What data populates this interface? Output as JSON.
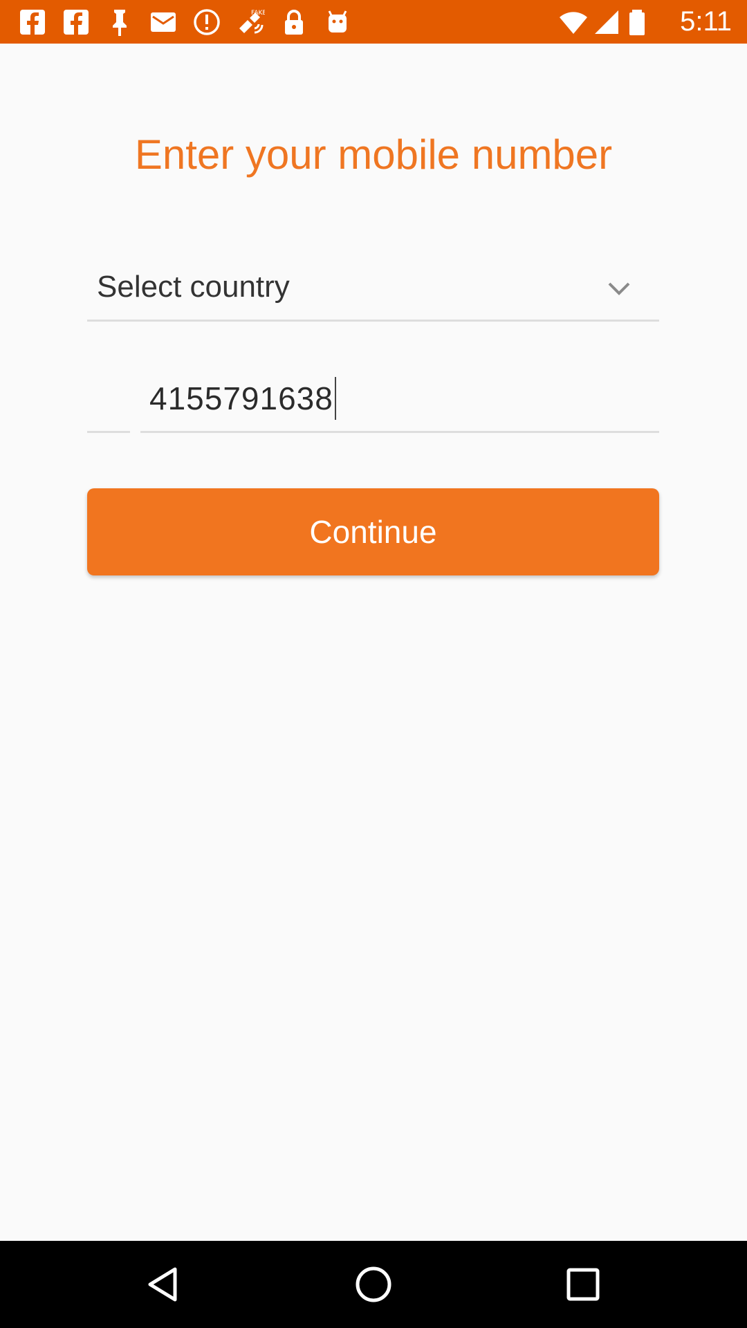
{
  "status_bar": {
    "time": "5:11",
    "background": "#e35b00",
    "left_icons": [
      "facebook-icon",
      "facebook-icon",
      "pin-icon",
      "mail-icon",
      "alert-icon",
      "fake-gps-icon",
      "lock-icon",
      "android-icon"
    ],
    "right_icons": [
      "wifi-icon",
      "signal-icon",
      "battery-icon"
    ]
  },
  "main": {
    "title": "Enter your mobile number",
    "title_color": "#ef7622",
    "country_select": {
      "value": "Select country",
      "icon": "chevron-down-icon"
    },
    "country_code": {
      "value": ""
    },
    "phone_number": {
      "value": "4155791638"
    },
    "continue_button": {
      "label": "Continue",
      "color": "#f1751f"
    }
  },
  "nav_bar": {
    "buttons": [
      "back-icon",
      "home-icon",
      "recents-icon"
    ]
  }
}
